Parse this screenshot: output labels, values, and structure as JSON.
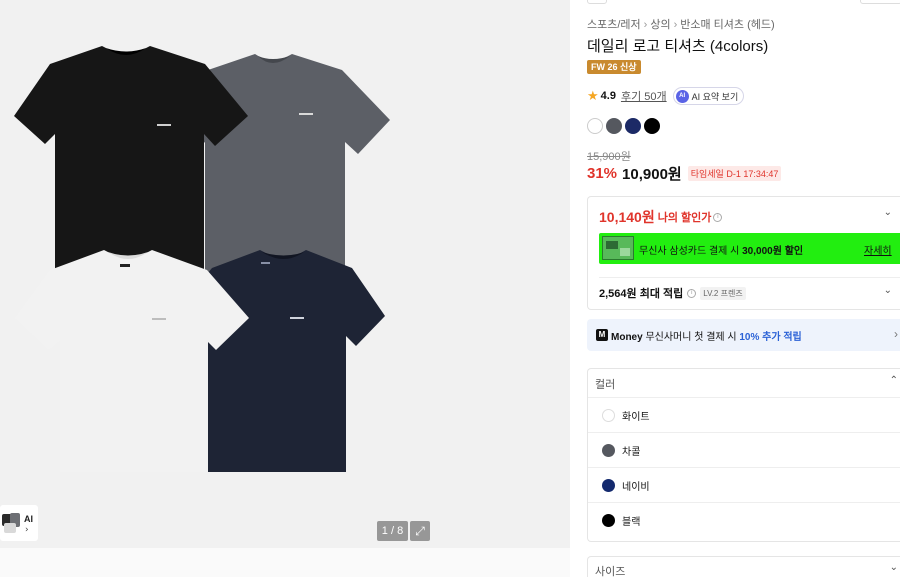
{
  "gallery": {
    "pager": "1 / 8",
    "thumb_label": "AI",
    "thumb_chevron": "›",
    "expand_icon": "⤢",
    "shirts": [
      {
        "name": "black",
        "color": "#161616"
      },
      {
        "name": "charcoal",
        "color": "#5c5f66"
      },
      {
        "name": "white",
        "color": "#f2f2f2"
      },
      {
        "name": "navy",
        "color": "#1e2435"
      }
    ]
  },
  "breadcrumb": [
    "스포츠/레저",
    "상의",
    "반소매 티셔츠 (헤드)"
  ],
  "product": {
    "title": "데일리 로고 티셔츠 (4colors)",
    "badge": "FW 26 신상",
    "rating": "4.9",
    "reviews": "후기 50개",
    "ai_label": "AI",
    "ai_summary": "AI 요약 보기",
    "swatches": [
      "#ffffff",
      "#55585f",
      "#1c2a66",
      "#000000"
    ],
    "original_price": "15,900원",
    "discount": "31%",
    "price": "10,900원",
    "timesale": "타임세일 D-1 17:34:47"
  },
  "my_discount": {
    "price": "10,140원",
    "label": "나의 할인가",
    "info": "i",
    "card_text_pre": "무신사 삼성카드 결제 시 ",
    "card_text_bold": "30,000원 할인",
    "card_detail": "자세히",
    "points": "2,564원 최대 적립",
    "level": "LV.2 프렌즈",
    "chevron": "⌄"
  },
  "money": {
    "icon": "M",
    "brand": "Money",
    "text_pre": " 무신사머니 첫 결제 시 ",
    "text_highlight": "10% 추가 적립",
    "chevron": "›"
  },
  "options": {
    "color_header": "컬러",
    "color_chevron": "⌃",
    "colors": [
      {
        "label": "화이트",
        "dot": "#ffffff"
      },
      {
        "label": "차콜",
        "dot": "#55585f"
      },
      {
        "label": "네이비",
        "dot": "#142a6e"
      },
      {
        "label": "블랙",
        "dot": "#000000"
      }
    ],
    "size_header": "사이즈",
    "size_chevron": "⌄"
  },
  "colors": {
    "accent_red": "#e0342b",
    "badge_gold": "#c98a2e",
    "ai_purple": "#5a63e6",
    "card_banner_green": "#22ee10",
    "money_blue": "#2b62d6"
  }
}
